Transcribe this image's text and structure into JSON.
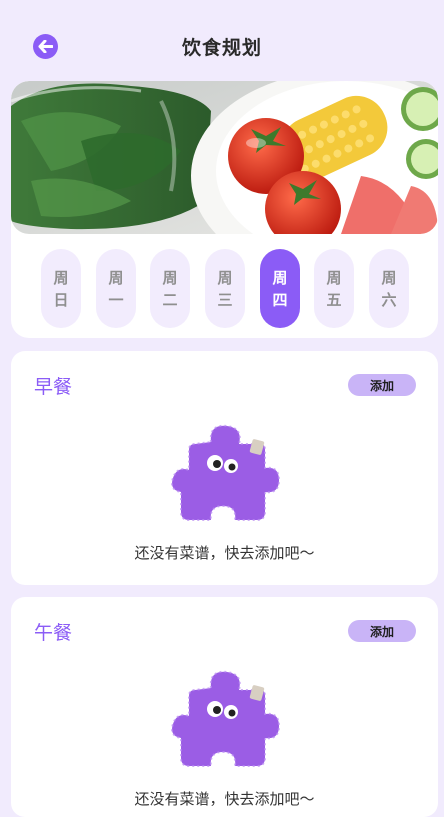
{
  "header": {
    "title": "饮食规划",
    "back_icon": "arrow-left-icon"
  },
  "banner": {
    "description_hidden": ""
  },
  "days": [
    {
      "top": "周",
      "bottom": "日",
      "active": false
    },
    {
      "top": "周",
      "bottom": "一",
      "active": false
    },
    {
      "top": "周",
      "bottom": "二",
      "active": false
    },
    {
      "top": "周",
      "bottom": "三",
      "active": false
    },
    {
      "top": "周",
      "bottom": "四",
      "active": true
    },
    {
      "top": "周",
      "bottom": "五",
      "active": false
    },
    {
      "top": "周",
      "bottom": "六",
      "active": false
    }
  ],
  "meals": [
    {
      "title": "早餐",
      "add_label": "添加",
      "empty_text": "还没有菜谱，快去添加吧～"
    },
    {
      "title": "午餐",
      "add_label": "添加",
      "empty_text": "还没有菜谱，快去添加吧～"
    }
  ],
  "colors": {
    "accent": "#8b5cf6",
    "background": "#f1ebfd",
    "add_button": "#c9b4f7"
  }
}
